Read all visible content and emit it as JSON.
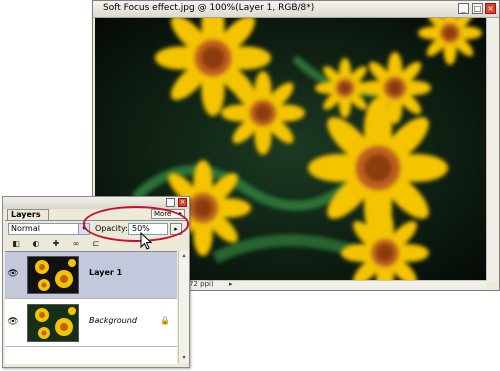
{
  "document": {
    "title": "Soft Focus effect.jpg @ 100%(Layer 1, RGB/8*)",
    "min_label": "_",
    "max_label": "□",
    "close_label": "×",
    "zoom_text": "72 ppi)",
    "status_arrow": "▸"
  },
  "layers_palette": {
    "tab_label": "Layers",
    "more_label": "More",
    "more_arrow": "▸",
    "blend_mode": "Normal",
    "blend_dropdown_icon": "▾",
    "opacity_label": "Opacity:",
    "opacity_value": "50%",
    "opacity_arrow": "▸",
    "close_label": "×",
    "tools": [
      "lock-transparency-icon",
      "lock-image-icon",
      "lock-position-icon",
      "link-icon",
      "lock-all-icon"
    ],
    "tool_glyphs": [
      "◧",
      "◐",
      "✚",
      "∞",
      "⊏"
    ],
    "layers": [
      {
        "name": "Layer 1",
        "eye": "👁",
        "selected": true
      },
      {
        "name": "Background",
        "eye": "👁",
        "lock": "🔒",
        "selected": false
      }
    ],
    "scroll_up": "▴",
    "scroll_down": "▾"
  },
  "colors": {
    "highlight": "#c8102e",
    "selected_row": "#c3c8dd",
    "canvas_bg": "#0a120c",
    "petal": "#f5c400",
    "center": "#c0601a"
  }
}
